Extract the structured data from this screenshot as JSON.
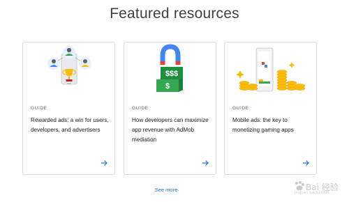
{
  "section": {
    "title": "Featured resources"
  },
  "cards": [
    {
      "type": "GUIDE",
      "title": "Rewarded ads: a win for users, developers, and advertisers",
      "illustration": "trophy-people-icon"
    },
    {
      "type": "GUIDE",
      "title": "How developers can maximize app revenue with AdMob mediation",
      "illustration": "magnet-money-icon"
    },
    {
      "type": "GUIDE",
      "title": "Mobile ads: the key to monetizing gaming apps",
      "illustration": "coins-phone-icon"
    }
  ],
  "arrow_icon": "arrow-right-icon",
  "see_more": {
    "label": "See more"
  },
  "watermark": {
    "text": "Bai 经验",
    "subtext": "jingyan.baidu.com"
  },
  "colors": {
    "link": "#1a73e8",
    "card_border": "#dadce0",
    "green": "#34a853",
    "blue": "#4285f4",
    "yellow": "#fbbc04",
    "red": "#ea4335"
  }
}
